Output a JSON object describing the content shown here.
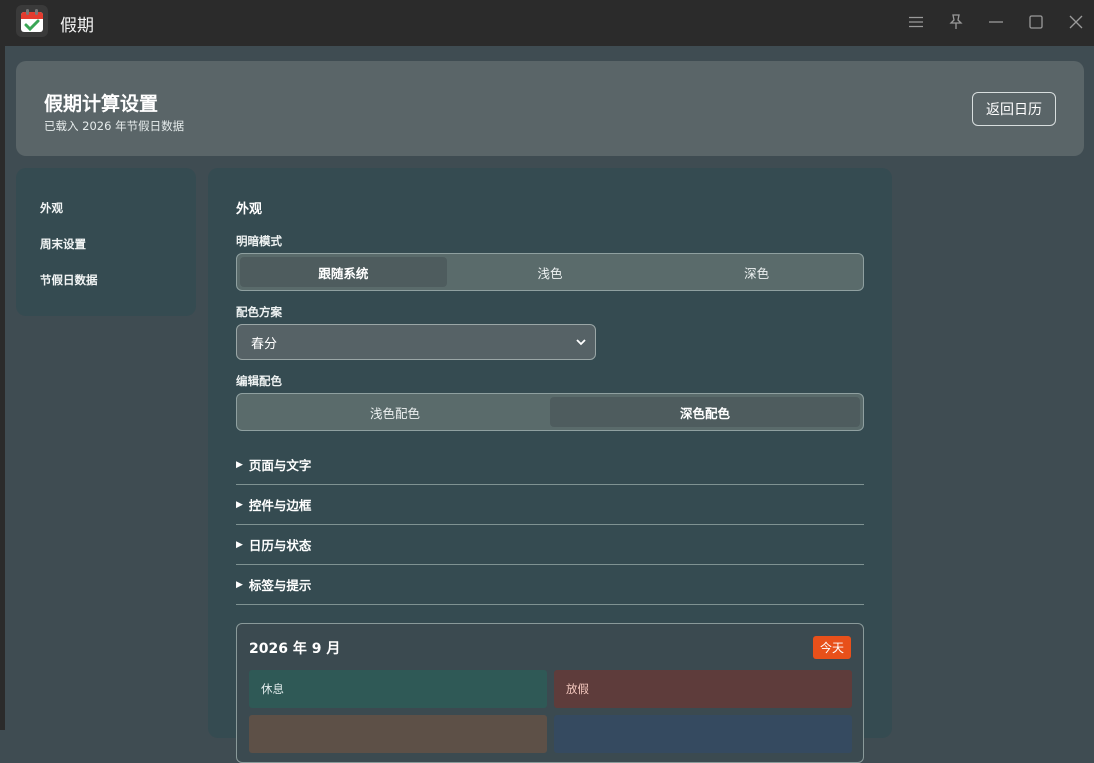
{
  "window": {
    "title": "假期"
  },
  "header": {
    "title": "假期计算设置",
    "subtitle": "已载入 2026 年节假日数据",
    "back_label": "返回日历"
  },
  "sidebar": {
    "items": [
      {
        "label": "外观"
      },
      {
        "label": "周末设置"
      },
      {
        "label": "节假日数据"
      }
    ]
  },
  "main": {
    "section_title": "外观",
    "mode": {
      "label": "明暗模式",
      "options": [
        "跟随系统",
        "浅色",
        "深色"
      ],
      "selected": "跟随系统"
    },
    "scheme": {
      "label": "配色方案",
      "value": "春分"
    },
    "edit": {
      "label": "编辑配色",
      "options": [
        "浅色配色",
        "深色配色"
      ],
      "selected": "深色配色"
    },
    "accordions": [
      "页面与文字",
      "控件与边框",
      "日历与状态",
      "标签与提示"
    ],
    "preview": {
      "title": "2026 年 9 月",
      "today_label": "今天",
      "rest_label": "休息",
      "holiday_label": "放假"
    }
  },
  "colors": {
    "accent": "#e8501a",
    "rest_tile": "#2f5956",
    "holiday_tile": "#5e3c3b",
    "work_tile": "#5d5047",
    "extra_tile": "#354a60"
  }
}
